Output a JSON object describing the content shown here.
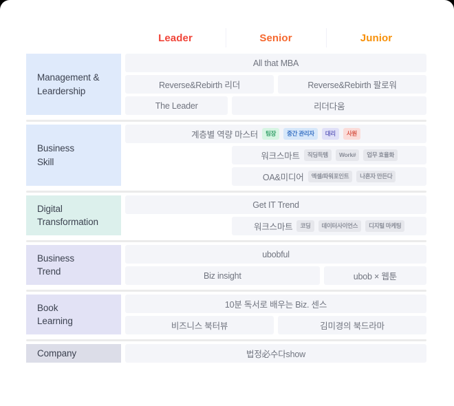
{
  "header": {
    "columns": [
      {
        "label": "Leader",
        "color": "#f04438"
      },
      {
        "label": "Senior",
        "color": "#f5682e"
      },
      {
        "label": "Junior",
        "color": "#f79009"
      }
    ]
  },
  "rows": [
    {
      "category": "Management &\nLeardership",
      "category_color": "#dfeafb",
      "lanes": [
        [
          {
            "label": "All that MBA",
            "span": 3,
            "tags": []
          }
        ],
        [
          {
            "label": "Reverse&Rebirth  리더",
            "span": 1.5,
            "tags": []
          },
          {
            "label": "Reverse&Rebirth  팔로워",
            "span": 1.5,
            "tags": []
          }
        ],
        [
          {
            "label": "The Leader",
            "span": 1,
            "tags": []
          },
          {
            "label": "리더다움",
            "span": 2,
            "tags": []
          }
        ]
      ]
    },
    {
      "category": "Business\nSkill",
      "category_color": "#dfeafb",
      "lanes": [
        [
          {
            "label": "계층별 역량 마스터",
            "span": 3,
            "tags": [
              {
                "text": "팀장",
                "color": "green"
              },
              {
                "text": "중간 관리자",
                "color": "blue"
              },
              {
                "text": "대리",
                "color": "purple"
              },
              {
                "text": "사원",
                "color": "red"
              }
            ]
          }
        ],
        [
          {
            "label": "",
            "span": 1,
            "spacer": true,
            "tags": []
          },
          {
            "label": "워크스마트",
            "span": 2,
            "tags": [
              {
                "text": "직딩득템",
                "color": "gray"
              },
              {
                "text": "Work#",
                "color": "gray"
              },
              {
                "text": "업무 효율화",
                "color": "gray"
              }
            ]
          }
        ],
        [
          {
            "label": "",
            "span": 1,
            "spacer": true,
            "tags": []
          },
          {
            "label": "OA&미디어",
            "span": 2,
            "tags": [
              {
                "text": "엑셀/파워포인트",
                "color": "gray"
              },
              {
                "text": "나혼자 만든다",
                "color": "gray"
              }
            ]
          }
        ]
      ]
    },
    {
      "category": "Digital\nTransformation",
      "category_color": "#dcf0ec",
      "lanes": [
        [
          {
            "label": "Get IT Trend",
            "span": 3,
            "tags": []
          }
        ],
        [
          {
            "label": "",
            "span": 1,
            "spacer": true,
            "tags": []
          },
          {
            "label": "워크스마트",
            "span": 2,
            "tags": [
              {
                "text": "코딩",
                "color": "gray"
              },
              {
                "text": "데이터사이언스",
                "color": "gray"
              },
              {
                "text": "디지털 마케팅",
                "color": "gray"
              }
            ]
          }
        ]
      ]
    },
    {
      "category": "Business\nTrend",
      "category_color": "#e2e2f5",
      "lanes": [
        [
          {
            "label": "ubobful",
            "span": 3,
            "tags": []
          }
        ],
        [
          {
            "label": "Biz insight",
            "span": 2,
            "tags": []
          },
          {
            "label": "ubob × 웹툰",
            "span": 1,
            "tags": []
          }
        ]
      ]
    },
    {
      "category": "Book\nLearning",
      "category_color": "#e2e2f5",
      "lanes": [
        [
          {
            "label": "10분 독서로 배우는 Biz. 센스",
            "span": 3,
            "tags": []
          }
        ],
        [
          {
            "label": "비즈니스 북터뷰",
            "span": 1.5,
            "tags": []
          },
          {
            "label": "김미경의 북드라마",
            "span": 1.5,
            "tags": []
          }
        ]
      ]
    },
    {
      "category": "Company",
      "category_color": "#dcdde8",
      "lanes": [
        [
          {
            "label": "법정必수다show",
            "span": 3,
            "tags": []
          }
        ]
      ]
    }
  ]
}
